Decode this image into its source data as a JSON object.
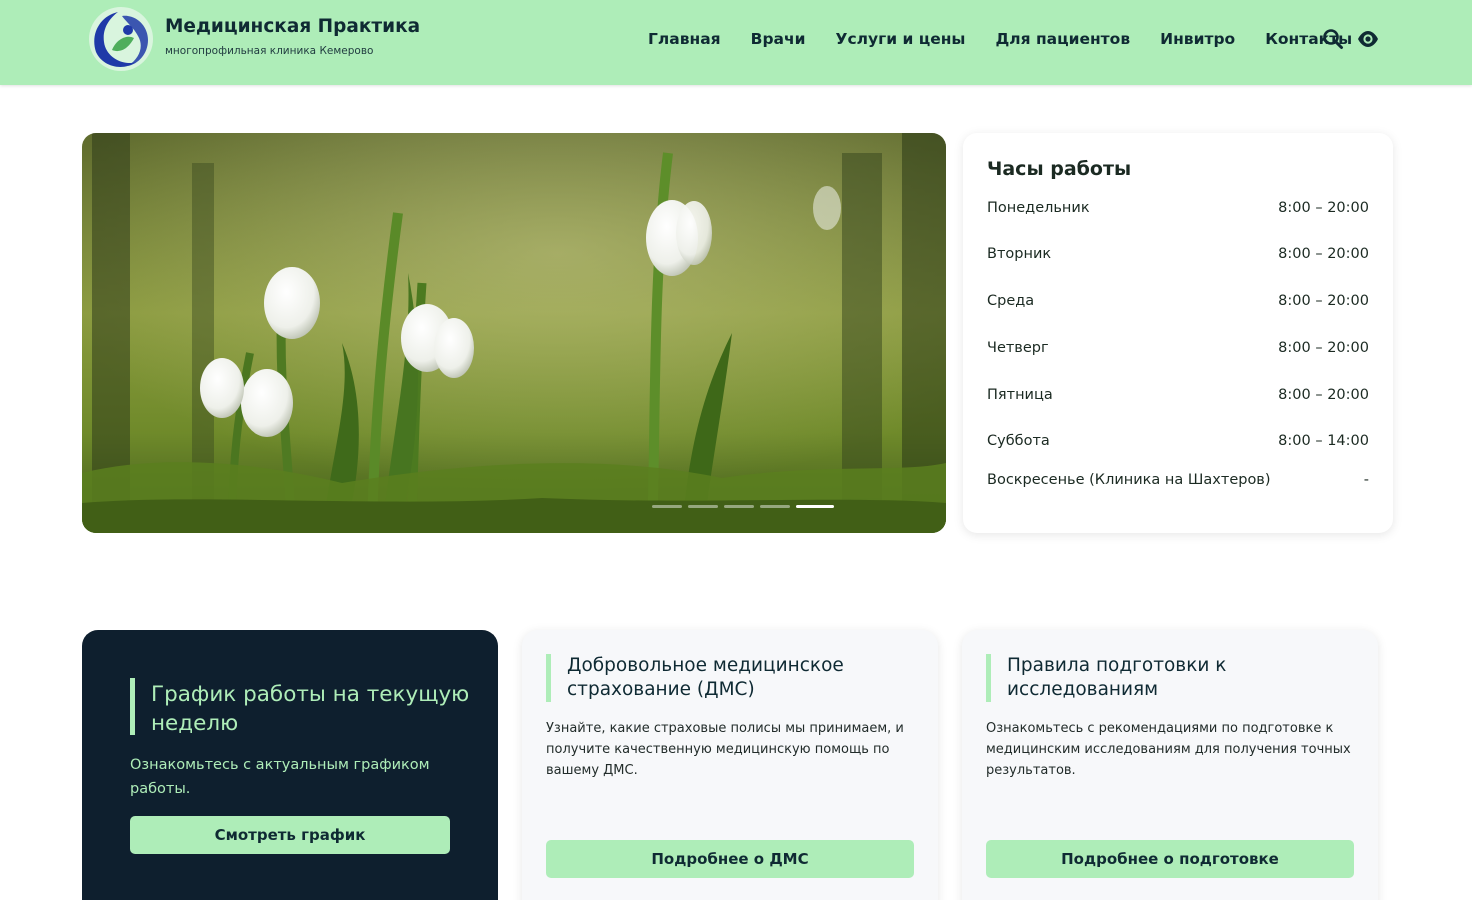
{
  "header": {
    "brand_title": "Медицинская Практика",
    "brand_subtitle": "многопрофильная клиника Кемерово",
    "nav": [
      {
        "label": "Главная"
      },
      {
        "label": "Врачи"
      },
      {
        "label": "Услуги и цены"
      },
      {
        "label": "Для пациентов"
      },
      {
        "label": "Инвитро"
      },
      {
        "label": "Контакты"
      }
    ],
    "icons": [
      "search-icon",
      "eye-icon"
    ]
  },
  "slider": {
    "slide_count": 5,
    "active_slide": 5
  },
  "hours": {
    "title": "Часы работы",
    "rows": [
      {
        "day": "Понедельник",
        "time": "8:00 – 20:00"
      },
      {
        "day": "Вторник",
        "time": "8:00 – 20:00"
      },
      {
        "day": "Среда",
        "time": "8:00 – 20:00"
      },
      {
        "day": "Четверг",
        "time": "8:00 – 20:00"
      },
      {
        "day": "Пятница",
        "time": "8:00 – 20:00"
      },
      {
        "day": "Суббота",
        "time": "8:00 – 14:00"
      },
      {
        "day": "Воскресенье (Клиника на Шахтеров)",
        "time": "-"
      }
    ]
  },
  "cards": [
    {
      "title": "График работы на текущую неделю",
      "text": "Ознакомьтесь с актуальным графиком работы.",
      "button": "Смотреть график"
    },
    {
      "title": "Добровольное медицинское страхование (ДМС)",
      "text": "Узнайте, какие страховые полисы мы принимаем, и получите качественную медицинскую помощь по вашему ДМС.",
      "button": "Подробнее о ДМС"
    },
    {
      "title": "Правила подготовки к исследованиям",
      "text": "Ознакомьтесь с рекомендациями по подготовке к медицинским исследованиям для получения точных результатов.",
      "button": "Подробнее о подготовке"
    }
  ],
  "colors": {
    "header_bg": "#aeedb8",
    "accent": "#aeedb8",
    "dark_card": "#0e1f2e",
    "logo_blue": "#1f3aa8"
  }
}
